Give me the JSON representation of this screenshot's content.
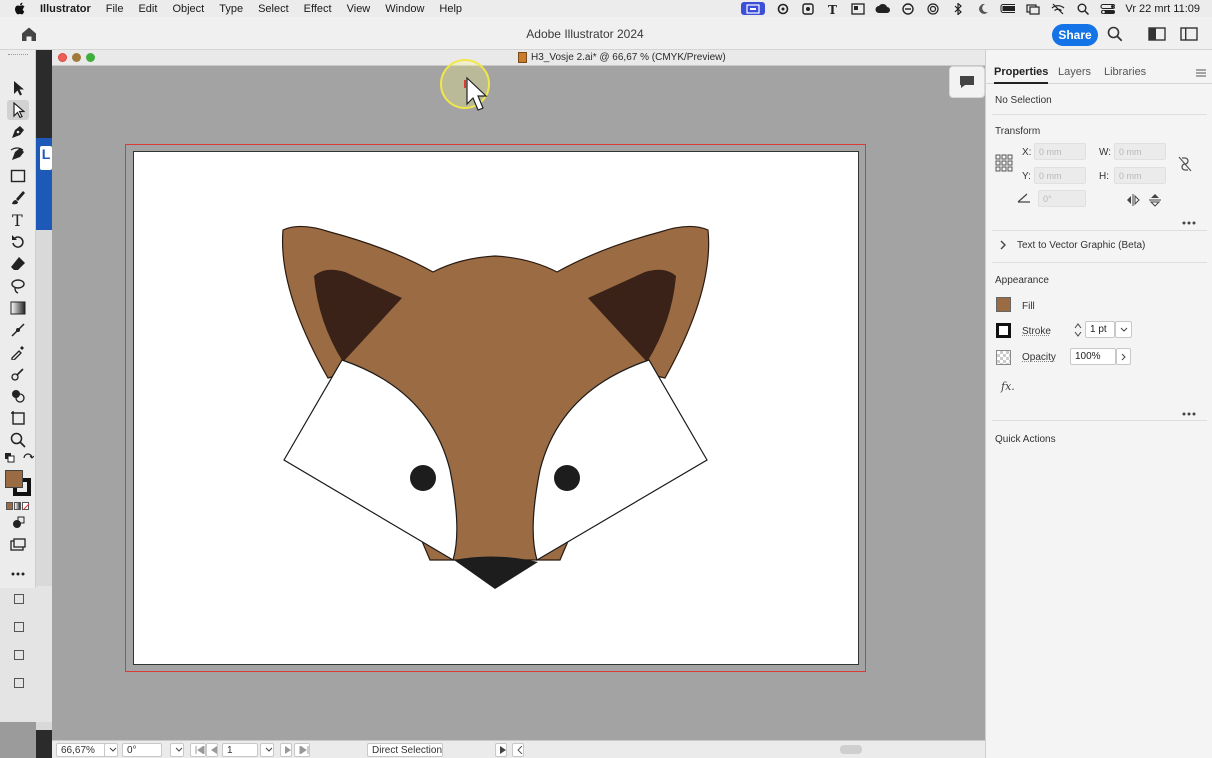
{
  "menubar": {
    "app": "Illustrator",
    "items": [
      "File",
      "Edit",
      "Object",
      "Type",
      "Select",
      "Effect",
      "View",
      "Window",
      "Help"
    ],
    "clock": "Vr 22 mrt  11:09"
  },
  "app_header": {
    "title": "Adobe Illustrator 2024",
    "share_label": "Share"
  },
  "document": {
    "title": "H3_Vosje 2.ai* @ 66,67 % (CMYK/Preview)"
  },
  "statusbar": {
    "zoom": "66,67%",
    "rotation": "0°",
    "artboard_number": "1",
    "current_tool": "Direct Selection"
  },
  "panel": {
    "tabs": [
      "Properties",
      "Layers",
      "Libraries"
    ],
    "selection_state": "No Selection",
    "transform": {
      "title": "Transform",
      "x_label": "X:",
      "x_value": "0 mm",
      "y_label": "Y:",
      "y_value": "0 mm",
      "w_label": "W:",
      "w_value": "0 mm",
      "h_label": "H:",
      "h_value": "0 mm",
      "angle_value": "0°"
    },
    "text_to_vector": "Text to Vector Graphic (Beta)",
    "appearance": {
      "title": "Appearance",
      "fill_label": "Fill",
      "stroke_label": "Stroke",
      "stroke_weight": "1 pt",
      "opacity_label": "Opacity",
      "opacity_value": "100%",
      "fill_color": "#9b6b43"
    },
    "quick_actions": "Quick Actions"
  },
  "colors": {
    "accent": "#1473e6",
    "fox_brown": "#9b6b43",
    "fox_dark": "#3a2218",
    "bleed": "#d93a3a"
  }
}
